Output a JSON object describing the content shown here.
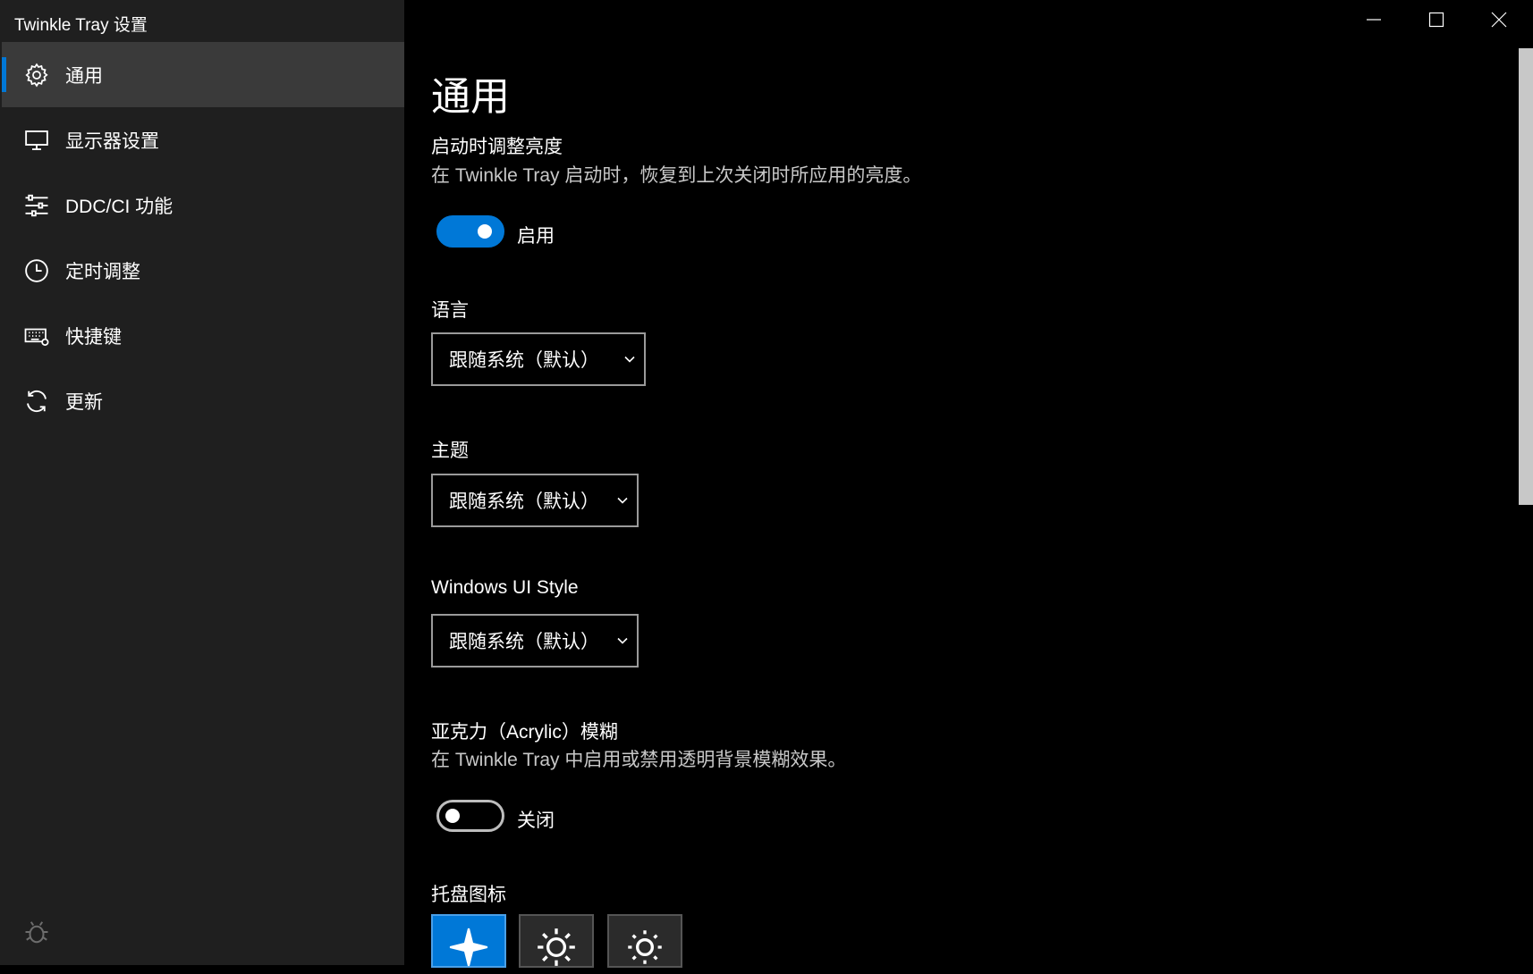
{
  "window": {
    "title": "Twinkle Tray 设置"
  },
  "sidebar": {
    "items": [
      {
        "label": "通用",
        "icon": "gear-icon",
        "active": true
      },
      {
        "label": "显示器设置",
        "icon": "monitor-icon",
        "active": false
      },
      {
        "label": "DDC/CI 功能",
        "icon": "sliders-icon",
        "active": false
      },
      {
        "label": "定时调整",
        "icon": "clock-icon",
        "active": false
      },
      {
        "label": "快捷键",
        "icon": "keyboard-icon",
        "active": false
      },
      {
        "label": "更新",
        "icon": "refresh-icon",
        "active": false
      }
    ]
  },
  "main": {
    "page_title": "通用",
    "startup": {
      "title": "启动时调整亮度",
      "description": "在 Twinkle Tray 启动时，恢复到上次关闭时所应用的亮度。",
      "toggle_label": "启用",
      "enabled": true
    },
    "language": {
      "title": "语言",
      "value": "跟随系统（默认）"
    },
    "theme": {
      "title": "主题",
      "value": "跟随系统（默认）"
    },
    "ui_style": {
      "title": "Windows UI Style",
      "value": "跟随系统（默认）"
    },
    "acrylic": {
      "title": "亚克力（Acrylic）模糊",
      "description": "在 Twinkle Tray 中启用或禁用透明背景模糊效果。",
      "toggle_label": "关闭",
      "enabled": false
    },
    "tray_icon": {
      "title": "托盘图标",
      "options": [
        "sparkle-icon",
        "sun-icon",
        "sun-outline-icon"
      ],
      "selected": 0
    }
  },
  "colors": {
    "accent": "#0078d7",
    "sidebar_bg": "#1f1f1f",
    "active_item_bg": "#3a3a3a",
    "main_bg": "#000000"
  }
}
